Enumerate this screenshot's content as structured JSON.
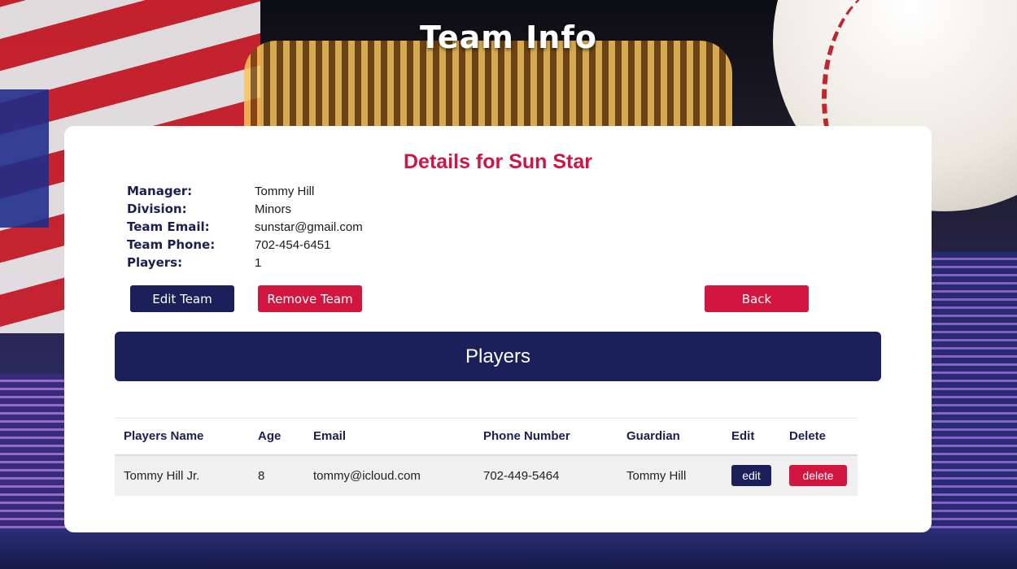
{
  "page": {
    "title": "Team Info"
  },
  "team": {
    "heading": "Details for Sun Star",
    "details": [
      {
        "label": "Manager:",
        "value": "Tommy Hill"
      },
      {
        "label": "Division:",
        "value": "Minors"
      },
      {
        "label": "Team Email:",
        "value": "sunstar@gmail.com"
      },
      {
        "label": "Team Phone:",
        "value": "702-454-6451"
      },
      {
        "label": "Players:",
        "value": "1"
      }
    ]
  },
  "actions": {
    "edit_team": "Edit Team",
    "remove_team": "Remove Team",
    "back": "Back"
  },
  "players_section": {
    "title": "Players",
    "columns": [
      "Players Name",
      "Age",
      "Email",
      "Phone Number",
      "Guardian",
      "Edit",
      "Delete"
    ],
    "rows": [
      {
        "name": "Tommy Hill Jr.",
        "age": "8",
        "email": "tommy@icloud.com",
        "phone": "702-449-5464",
        "guardian": "Tommy Hill",
        "edit_label": "edit",
        "delete_label": "delete"
      }
    ]
  },
  "colors": {
    "navy": "#1b1f5a",
    "red": "#d3163f",
    "heading_red": "#cc1744"
  }
}
